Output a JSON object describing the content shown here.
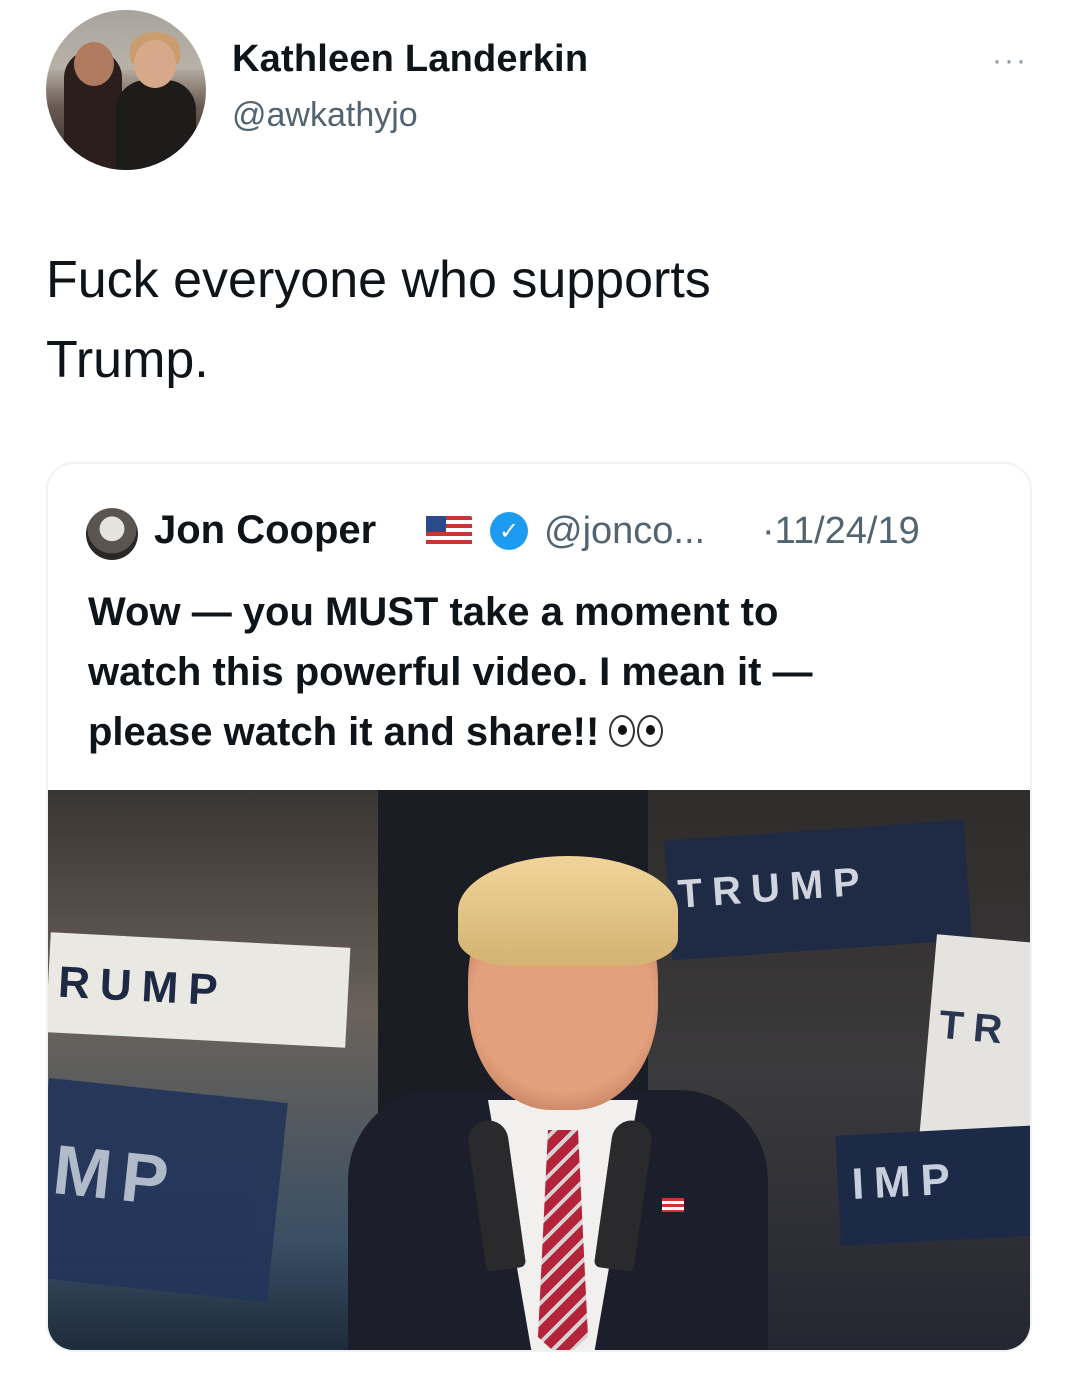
{
  "tweet": {
    "author_name": "Kathleen Landerkin",
    "author_handle": "@awkathyjo",
    "more_label": "···",
    "text_line1": "Fuck everyone who supports",
    "text_line2": "Trump."
  },
  "quoted_tweet": {
    "author_name": "Jon Cooper",
    "author_handle": "@jonco...",
    "date": "·11/24/19",
    "verified_mark": "✓",
    "text_line1": "Wow — you MUST take a moment to",
    "text_line2": "watch this powerful video. I mean it —",
    "text_line3": "please watch it and share!!",
    "emoji": "eyes"
  },
  "video": {
    "sign_texts": [
      "RUMP",
      "TRUMP",
      "MP",
      "TR",
      "IMP"
    ]
  },
  "colors": {
    "verified_blue": "#1d9bf0",
    "secondary_text": "#536471",
    "border": "#eff3f4"
  }
}
